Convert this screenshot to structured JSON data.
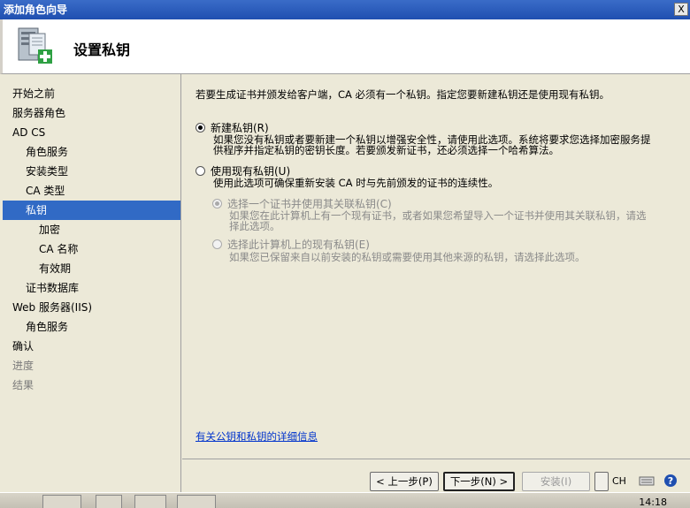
{
  "window": {
    "title": "添加角色向导",
    "close_label": "X"
  },
  "banner": {
    "title": "设置私钥",
    "icon": "server-add-icon"
  },
  "sidebar": {
    "items": [
      {
        "label": "开始之前",
        "level": 0,
        "state": "normal"
      },
      {
        "label": "服务器角色",
        "level": 0,
        "state": "normal"
      },
      {
        "label": "AD CS",
        "level": 0,
        "state": "normal"
      },
      {
        "label": "角色服务",
        "level": 1,
        "state": "normal"
      },
      {
        "label": "安装类型",
        "level": 1,
        "state": "normal"
      },
      {
        "label": "CA 类型",
        "level": 1,
        "state": "normal"
      },
      {
        "label": "私钥",
        "level": 1,
        "state": "active"
      },
      {
        "label": "加密",
        "level": 2,
        "state": "normal"
      },
      {
        "label": "CA 名称",
        "level": 2,
        "state": "normal"
      },
      {
        "label": "有效期",
        "level": 2,
        "state": "normal"
      },
      {
        "label": "证书数据库",
        "level": 1,
        "state": "normal"
      },
      {
        "label": "Web 服务器(IIS)",
        "level": 0,
        "state": "normal"
      },
      {
        "label": "角色服务",
        "level": 1,
        "state": "normal"
      },
      {
        "label": "确认",
        "level": 0,
        "state": "normal"
      },
      {
        "label": "进度",
        "level": 0,
        "state": "disabled"
      },
      {
        "label": "结果",
        "level": 0,
        "state": "disabled"
      }
    ]
  },
  "main": {
    "intro": "若要生成证书并颁发给客户端，CA 必须有一个私钥。指定您要新建私钥还是使用现有私钥。",
    "options": {
      "new_key": {
        "label": "新建私钥(R)",
        "checked": true,
        "desc_line1": "如果您没有私钥或者要新建一个私钥以增强安全性，请使用此选项。系统将要求您选择加密服务提",
        "desc_line2": "供程序并指定私钥的密钥长度。若要颁发新证书，还必须选择一个哈希算法。"
      },
      "existing_key": {
        "label": "使用现有私钥(U)",
        "checked": false,
        "desc": "使用此选项可确保重新安装 CA 时与先前颁发的证书的连续性。"
      },
      "select_cert": {
        "label": "选择一个证书并使用其关联私钥(C)",
        "checked": true,
        "disabled": true,
        "desc_line1": "如果您在此计算机上有一个现有证书，或者如果您希望导入一个证书并使用其关联私钥，请选",
        "desc_line2": "择此选项。"
      },
      "select_key": {
        "label": "选择此计算机上的现有私钥(E)",
        "checked": false,
        "disabled": true,
        "desc": "如果您已保留来自以前安装的私钥或需要使用其他来源的私钥，请选择此选项。"
      }
    },
    "help_link": "有关公钥和私钥的详细信息"
  },
  "buttons": {
    "back": "< 上一步(P)",
    "next": "下一步(N) >",
    "install": "安装(I)",
    "cancel": ""
  },
  "tray": {
    "lang": "CH",
    "clock": "14:18"
  },
  "colors": {
    "titlebar": "#1f4fb0",
    "selection": "#316ac5",
    "link": "#0033cc"
  }
}
